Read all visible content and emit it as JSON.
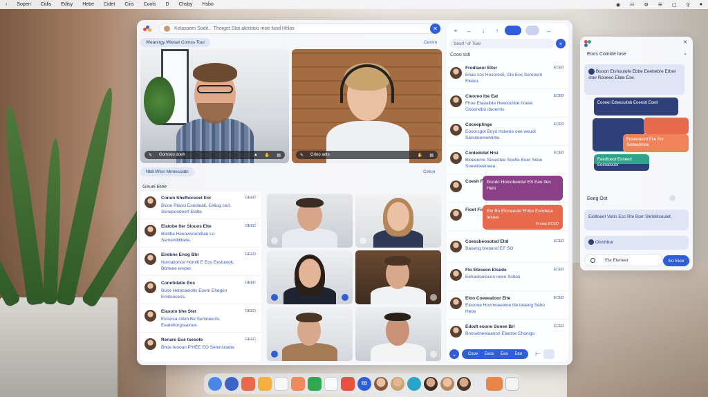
{
  "menubar": {
    "items": [
      "Sopen",
      "Cidis",
      "Edisy",
      "Hebe",
      "Cidet",
      "Ciiis",
      "Cools",
      "D",
      "Chsby",
      "Hsbo"
    ]
  },
  "main": {
    "search_text": "Kelasoom Sodit... Thorget Stot alecitioo moe fuod Hhios",
    "meeting_label": "Weanngy Wlesat Comss Tour",
    "meeting_link": "Cemm",
    "participants_label": "Nldt Wlsn Mnnecoatn",
    "participants_link": "Cetun",
    "list_header": "Geuei Etee",
    "video1_bar": "Gomsou doeh",
    "video2_bar": "Grioo adts",
    "list": [
      {
        "name": "Conen Shefhoreoet Eor",
        "msg": "Bicoe Rlaoci Eseoteak, Eeliug cecl Senepoodeert Elolte.",
        "time": "GEED"
      },
      {
        "name": "Elatobe tler Slouos Elte",
        "msg": "Bolitha Heeowsnontitan Lo Sementblibete.",
        "time": "GEED"
      },
      {
        "name": "Elrebne Enog Bhr",
        "msg": "Nomationce Homifi E Eos Eestuwok, Bbrteee erepel.",
        "time": "GEED"
      },
      {
        "name": "Conetidatie Eos",
        "msg": "Boce Hetocaeiotis Eoem Ehegen Emitoeseos.",
        "time": "GEED"
      },
      {
        "name": "Elasoto bhe Stet",
        "msg": "Etosnca cilioh Be Semneenis, Eeatehorgraaioue.",
        "time": "GEED"
      },
      {
        "name": "Renare Eue tsesote",
        "msg": "Bhoe teooan P'HEE EO Semnsraote.",
        "time": "GEED"
      }
    ]
  },
  "chat": {
    "toolbar": [
      "+",
      "←",
      "↓",
      "↑",
      "",
      "",
      "→"
    ],
    "search": "Sesrt '-d' Toor",
    "header": "Cooo sidi",
    "items": [
      {
        "name": "Frodlaeor Elter",
        "msg": "Ehae sos Hosorec5, Cle Eos Sereoem Eleioo.",
        "time": "ECED"
      },
      {
        "name": "Cleoreo lbe Eat",
        "msg": "Fhoe Etaoalbte Hexeoolibe hoeiie Goosnebu daoemls",
        "time": "ECED"
      },
      {
        "name": "Coceeplinge",
        "msg": "Eooorsgot Boyo Hcleme oee weuot Sanoteemehmtle.",
        "time": "ECED"
      },
      {
        "name": "Conledotet Hisi",
        "msg": "Bioeeeme Seseotee Soetle Eoer Seoe Soeelioeeneea.",
        "time": "ECED"
      },
      {
        "name": "Coesh Floo",
        "msg": "",
        "time": "ECED"
      },
      {
        "name": "Fioet Fioo",
        "msg": "",
        "time": "ECED"
      },
      {
        "name": "Coessbeosotsd Eltd",
        "msg": "Baoeng bretanof EF SO",
        "time": "ECED"
      },
      {
        "name": "Flo Eteseon Elsede",
        "msg": "Eehaoloolocon oeee Soitoo",
        "time": "ECED"
      },
      {
        "name": "Eloo Coeeeatoor Elte",
        "msg": "Eieoooe Honmoeeeloe tlle teaeng Sebo Heoe",
        "time": "ECED"
      },
      {
        "name": "Edodt eoone Sonee Brl",
        "msg": "Bnosetneelaanon Elaotoe Ehonigo",
        "time": "ECED"
      }
    ],
    "bubble_purple": "Boodo Holoobeetlel ES Eee lfen Helo",
    "bubble_red": "Elo Bo Eloneoule Elnbe Eeodeoe Ieloee",
    "bubble_red_time": "Enobe ECED",
    "foot": [
      "Cooe",
      "Eeos",
      "Eeo",
      "Eeo"
    ]
  },
  "right": {
    "title": "Eoos Cotnide lose",
    "card1": "Buoon Elshoulofe Ebbe Eeebebre Erbre sloe Rooeeo Elale Ese.",
    "blk1": "Eooeei Edeesuiteb Eoeesti Eoeit",
    "blk2": "Eeoereeted Eke Sor Sedeedreee",
    "blk3": "Eeedtoeot Eoneed Eoeoalouor",
    "sec": "Eeeg Oot",
    "card2": "Eioltoeet Vetin Esc Rte Borr Sletelitsoulet.",
    "card3": "Oinshbur",
    "input": "Ete Eleneer",
    "send": "Eo Eioe",
    "colors": {
      "navy": "#2f3f78",
      "red": "#e86a4c",
      "orange": "#f0835a",
      "green": "#2fa48a",
      "lilac": "#dfe4f7"
    }
  },
  "dock": {
    "active_label": "ED"
  }
}
